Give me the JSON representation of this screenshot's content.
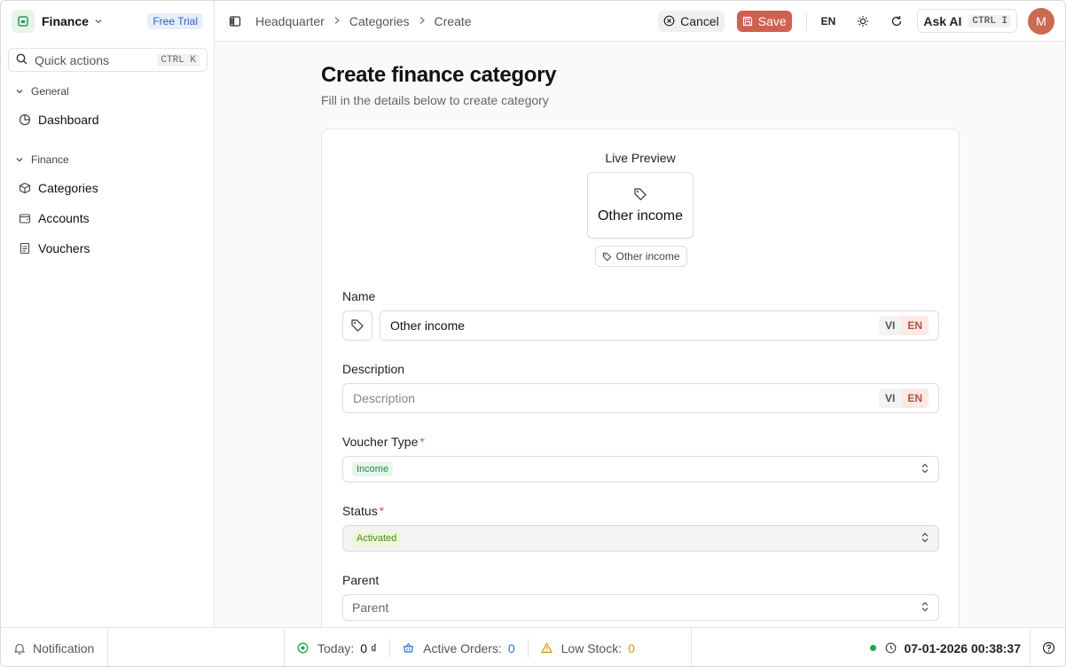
{
  "app": {
    "name": "Finance",
    "trial_badge": "Free Trial"
  },
  "quick_actions": {
    "label": "Quick actions",
    "shortcut": "CTRL K"
  },
  "sidebar": {
    "groups": [
      {
        "label": "General",
        "items": [
          {
            "label": "Dashboard",
            "icon": "pie-chart-icon"
          }
        ]
      },
      {
        "label": "Finance",
        "items": [
          {
            "label": "Categories",
            "icon": "box-icon"
          },
          {
            "label": "Accounts",
            "icon": "wallet-icon"
          },
          {
            "label": "Vouchers",
            "icon": "document-icon"
          }
        ]
      }
    ]
  },
  "breadcrumb": [
    "Headquarter",
    "Categories",
    "Create"
  ],
  "toolbar": {
    "cancel_label": "Cancel",
    "save_label": "Save",
    "language": "EN",
    "ask_ai_label": "Ask AI",
    "ask_ai_shortcut": "CTRL I",
    "avatar_initial": "M"
  },
  "page": {
    "title": "Create finance category",
    "subtitle": "Fill in the details below to create category"
  },
  "preview": {
    "label": "Live Preview",
    "name": "Other income",
    "chip": "Other income"
  },
  "form": {
    "name": {
      "label": "Name",
      "value": "Other income",
      "lang_vi": "VI",
      "lang_en": "EN"
    },
    "description": {
      "label": "Description",
      "placeholder": "Description",
      "lang_vi": "VI",
      "lang_en": "EN"
    },
    "voucher_type": {
      "label": "Voucher Type",
      "required": "*",
      "value": "Income"
    },
    "status": {
      "label": "Status",
      "required": "*",
      "value": "Activated"
    },
    "parent": {
      "label": "Parent",
      "placeholder": "Parent"
    }
  },
  "statusbar": {
    "notification": "Notification",
    "today_label": "Today:",
    "today_value": "0 ₫",
    "active_orders_label": "Active Orders:",
    "active_orders_value": "0",
    "low_stock_label": "Low Stock:",
    "low_stock_value": "0",
    "datetime": "07-01-2026 00:38:37"
  },
  "colors": {
    "accent": "#d2604e",
    "success": "#1ea94b",
    "info": "#2a74d6",
    "warning": "#d59a0e"
  }
}
